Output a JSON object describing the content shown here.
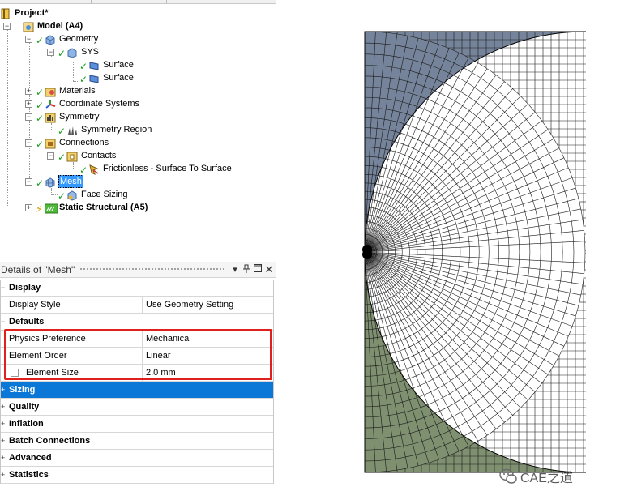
{
  "tree": {
    "items": [
      {
        "label": "Project*",
        "bold": true
      },
      {
        "label": "Model (A4)",
        "bold": true
      },
      {
        "label": "Geometry"
      },
      {
        "label": "SYS"
      },
      {
        "label": "Surface"
      },
      {
        "label": "Surface"
      },
      {
        "label": "Materials"
      },
      {
        "label": "Coordinate Systems"
      },
      {
        "label": "Symmetry"
      },
      {
        "label": "Symmetry Region"
      },
      {
        "label": "Connections"
      },
      {
        "label": "Contacts"
      },
      {
        "label": "Frictionless - Surface To Surface"
      },
      {
        "label": "Mesh",
        "selected": true
      },
      {
        "label": "Face Sizing"
      },
      {
        "label": "Static Structural (A5)",
        "bold": true
      }
    ]
  },
  "details": {
    "title": "Details of \"Mesh\"",
    "pin_icon": "pin-icon",
    "maximize_icon": "maximize-icon",
    "close_icon": "close-icon",
    "rows": [
      {
        "type": "group",
        "label": "Display"
      },
      {
        "type": "prop",
        "name": "Display Style",
        "value": "Use Geometry Setting"
      },
      {
        "type": "group",
        "label": "Defaults"
      },
      {
        "type": "prop",
        "name": "Physics Preference",
        "value": "Mechanical"
      },
      {
        "type": "prop",
        "name": "Element Order",
        "value": "Linear"
      },
      {
        "type": "prop",
        "name": "Element Size",
        "value": "2.0 mm",
        "checkbox": true
      },
      {
        "type": "group",
        "label": "Sizing",
        "collapsed": true,
        "selected": true
      },
      {
        "type": "group",
        "label": "Quality",
        "collapsed": true
      },
      {
        "type": "group",
        "label": "Inflation",
        "collapsed": true
      },
      {
        "type": "group",
        "label": "Batch Connections",
        "collapsed": true
      },
      {
        "type": "group",
        "label": "Advanced",
        "collapsed": true
      },
      {
        "type": "group",
        "label": "Statistics",
        "collapsed": true
      }
    ]
  },
  "view": {
    "top_body_color": "#76849b",
    "bottom_body_color": "#7f9070",
    "mesh_line_color": "#000000"
  },
  "watermark": {
    "text": "CAE之道"
  },
  "colors": {
    "selection": "#0b78d7",
    "highlight_box": "#e0201c",
    "check": "#1c9c1c"
  }
}
